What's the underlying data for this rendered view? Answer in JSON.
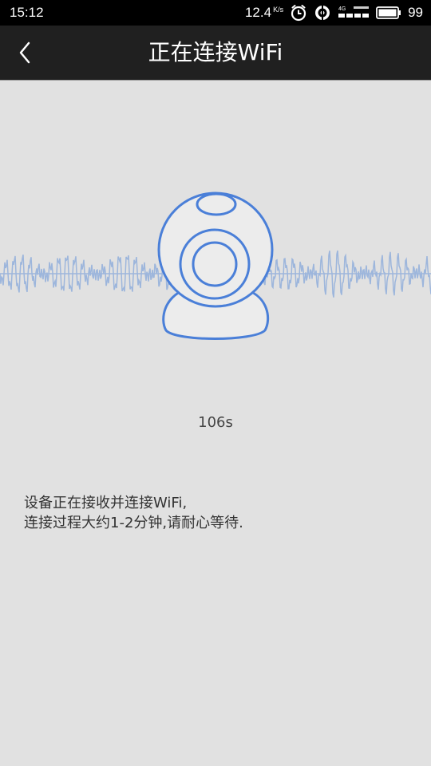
{
  "status_bar": {
    "time": "15:12",
    "net_speed": "12.4",
    "net_unit": "K/s",
    "network_badge": "4G",
    "battery": "99",
    "icons": [
      "alarm-icon",
      "wifi-hotspot-icon",
      "signal-icon",
      "battery-icon"
    ]
  },
  "header": {
    "title": "正在连接WiFi",
    "back_icon": "chevron-left-icon"
  },
  "illustration": {
    "device": "camera-icon",
    "accent_color": "#4a7fd8",
    "wave_color": "#9db6dc",
    "body_fill": "#ececec"
  },
  "countdown": "106s",
  "description": {
    "line1": "设备正在接收并连接WiFi,",
    "line2": "连接过程大约1-2分钟,请耐心等待."
  },
  "colors": {
    "background": "#e1e1e1",
    "header": "#202020",
    "status_bar": "#000000"
  }
}
